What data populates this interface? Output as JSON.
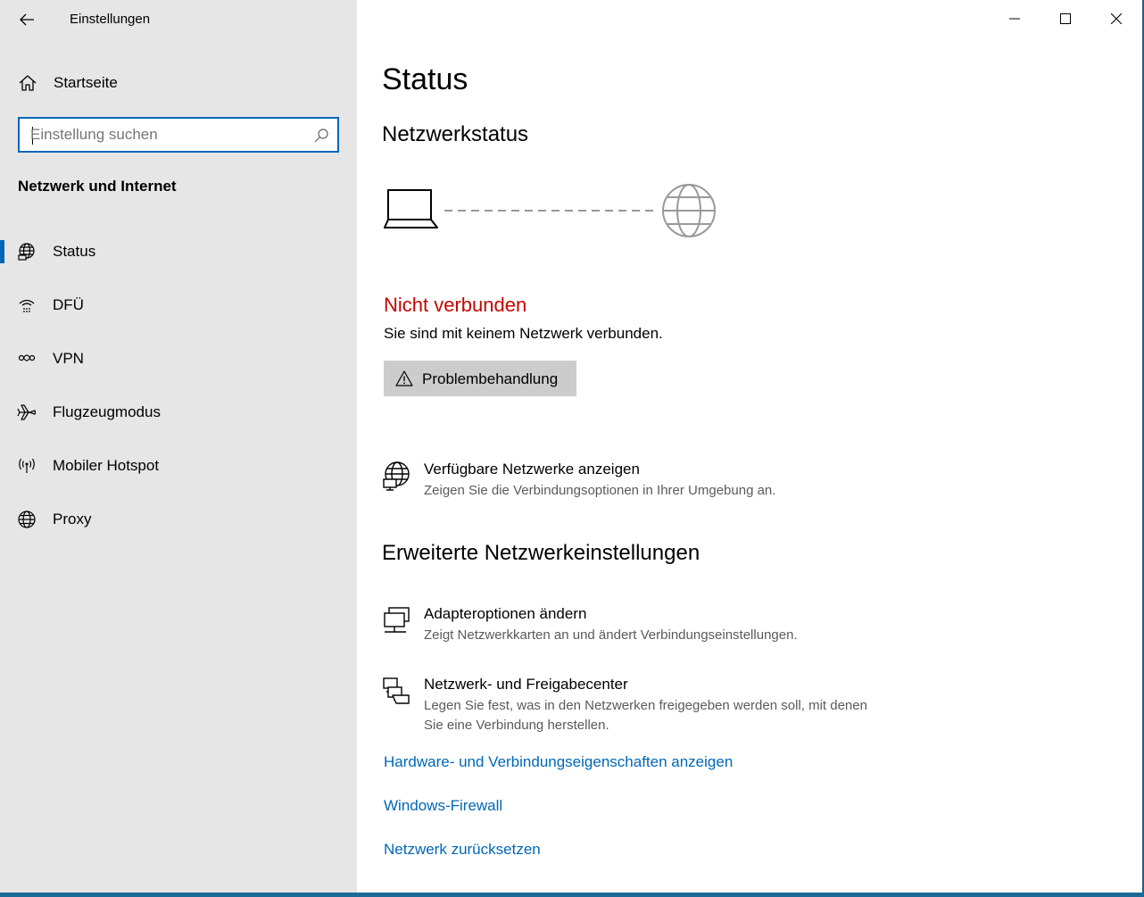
{
  "window": {
    "app_title": "Einstellungen",
    "accent_color": "#0067b8",
    "error_color": "#c50500"
  },
  "sidebar": {
    "home_label": "Startseite",
    "search_placeholder": "Einstellung suchen",
    "search_value": "",
    "section_title": "Netzwerk und Internet",
    "items": [
      {
        "label": "Status",
        "icon": "globe-network-icon",
        "selected": true
      },
      {
        "label": "DFÜ",
        "icon": "dialup-icon",
        "selected": false
      },
      {
        "label": "VPN",
        "icon": "vpn-icon",
        "selected": false
      },
      {
        "label": "Flugzeugmodus",
        "icon": "airplane-icon",
        "selected": false
      },
      {
        "label": "Mobiler Hotspot",
        "icon": "hotspot-icon",
        "selected": false
      },
      {
        "label": "Proxy",
        "icon": "globe-icon",
        "selected": false
      }
    ]
  },
  "main": {
    "page_title": "Status",
    "network_status_heading": "Netzwerkstatus",
    "connection_state": "Nicht verbunden",
    "connection_desc": "Sie sind mit keinem Netzwerk verbunden.",
    "troubleshoot_label": "Problembehandlung",
    "available_networks": {
      "title": "Verfügbare Netzwerke anzeigen",
      "desc": "Zeigen Sie die Verbindungsoptionen in Ihrer Umgebung an."
    },
    "advanced_heading": "Erweiterte Netzwerkeinstellungen",
    "adapter_options": {
      "title": "Adapteroptionen ändern",
      "desc": "Zeigt Netzwerkkarten an und ändert Verbindungseinstellungen."
    },
    "sharing_center": {
      "title": "Netzwerk- und Freigabecenter",
      "desc": "Legen Sie fest, was in den Netzwerken freigegeben werden soll, mit denen Sie eine Verbindung herstellen."
    },
    "links": [
      "Hardware- und Verbindungseigenschaften anzeigen",
      "Windows-Firewall",
      "Netzwerk zurücksetzen"
    ]
  }
}
